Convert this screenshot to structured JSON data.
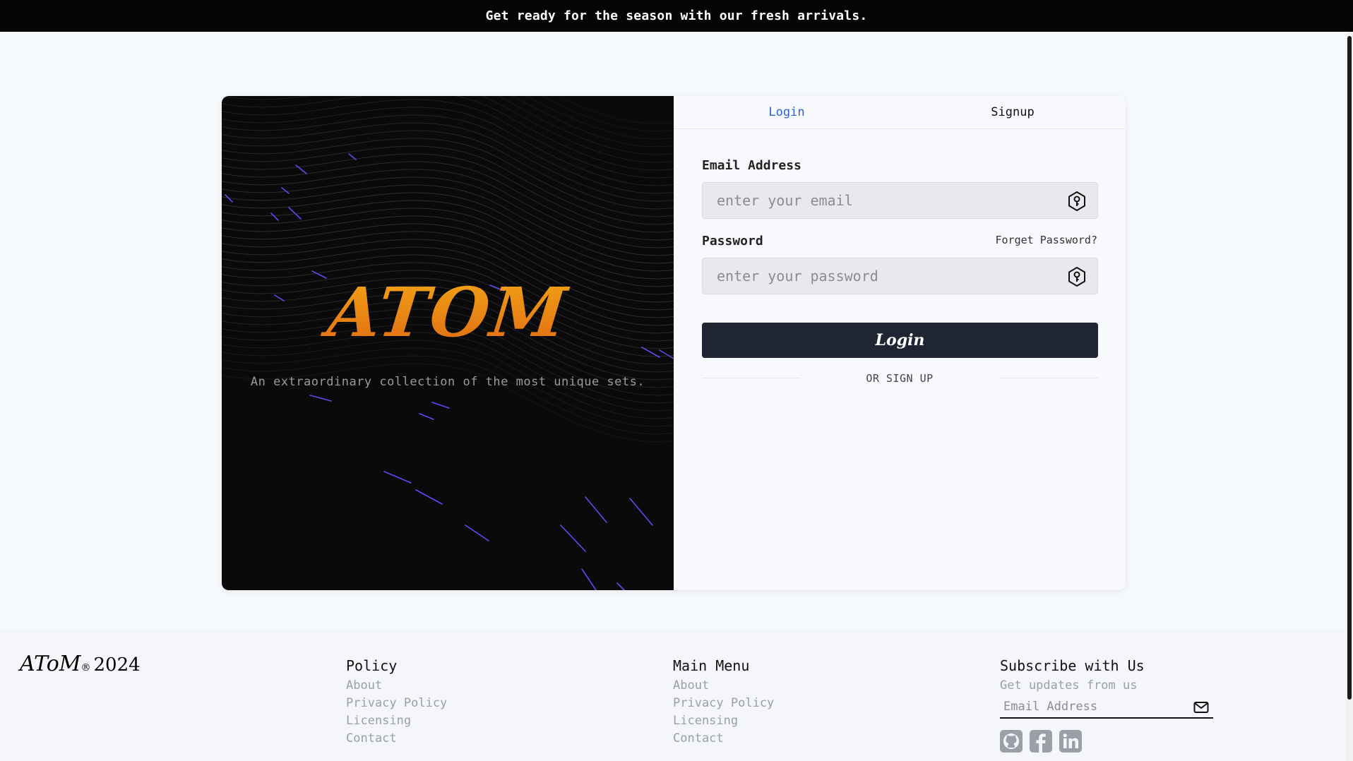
{
  "announcement": "Get ready for the season with our fresh arrivals.",
  "hero": {
    "logo": "ATOM",
    "tagline": "An extraordinary collection of the most unique sets."
  },
  "tabs": [
    {
      "label": "Login",
      "active": true
    },
    {
      "label": "Signup",
      "active": false
    }
  ],
  "form": {
    "email_label": "Email Address",
    "email_placeholder": "enter your email",
    "password_label": "Password",
    "password_placeholder": "enter your password",
    "forgot_label": "Forget Password?",
    "submit_label": "Login",
    "divider_text": "OR SIGN UP"
  },
  "footer": {
    "brand": "AToM",
    "brand_reg": "®",
    "brand_year": "2024",
    "policy": {
      "title": "Policy",
      "links": [
        "About",
        "Privacy Policy",
        "Licensing",
        "Contact"
      ]
    },
    "main_menu": {
      "title": "Main Menu",
      "links": [
        "About",
        "Privacy Policy",
        "Licensing",
        "Contact"
      ]
    },
    "subscribe": {
      "title": "Subscribe with Us",
      "subtitle": "Get updates from us",
      "placeholder": "Email Address"
    },
    "socials": [
      "github-icon",
      "facebook-icon",
      "linkedin-icon"
    ]
  },
  "colors": {
    "accent_tab": "#2f63c7",
    "button_bg": "#1f2533",
    "logo_gradient_top": "#f2a516",
    "logo_gradient_bottom": "#e06a12"
  }
}
